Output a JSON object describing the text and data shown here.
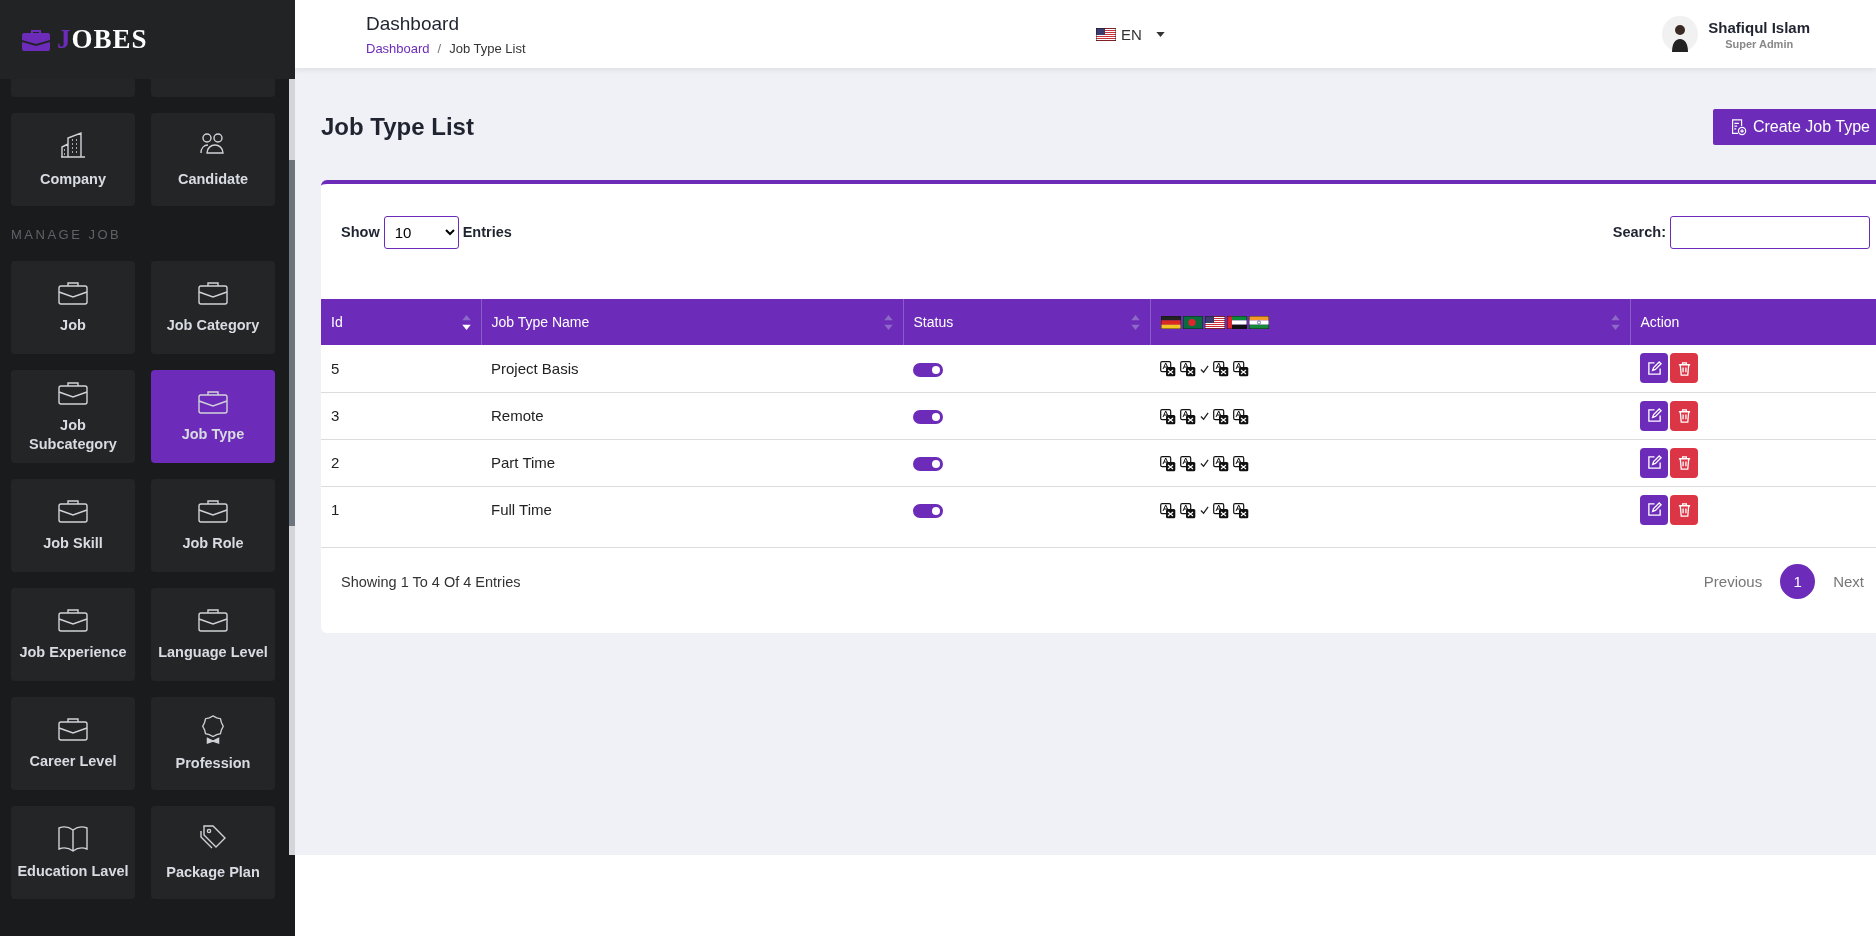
{
  "logo": {
    "text": "JOBES"
  },
  "sidebar": {
    "groups": [
      {
        "items": [
          {
            "label": "Company",
            "kind": "building",
            "selected": false
          },
          {
            "label": "Candidate",
            "kind": "people",
            "selected": false
          }
        ]
      },
      {
        "heading": "MANAGE JOB",
        "items": [
          {
            "label": "Job",
            "kind": "briefcase",
            "selected": false
          },
          {
            "label": "Job Category",
            "kind": "briefcase",
            "selected": false
          },
          {
            "label": "Job Subcategory",
            "kind": "briefcase",
            "selected": false
          },
          {
            "label": "Job Type",
            "kind": "briefcase",
            "selected": true
          },
          {
            "label": "Job Skill",
            "kind": "briefcase",
            "selected": false
          },
          {
            "label": "Job Role",
            "kind": "briefcase",
            "selected": false
          },
          {
            "label": "Job Experience",
            "kind": "briefcase",
            "selected": false
          },
          {
            "label": "Language Level",
            "kind": "briefcase",
            "selected": false
          },
          {
            "label": "Career Level",
            "kind": "briefcase",
            "selected": false
          },
          {
            "label": "Profession",
            "kind": "award",
            "selected": false
          },
          {
            "label": "Education Lavel",
            "kind": "book",
            "selected": false
          },
          {
            "label": "Package Plan",
            "kind": "tag",
            "selected": false
          }
        ]
      }
    ]
  },
  "header": {
    "title": "Dashboard",
    "breadcrumb": [
      {
        "label": "Dashboard",
        "link": true
      },
      {
        "label": "Job Type List",
        "link": false
      }
    ],
    "breadcrumb_separator": "/",
    "language": "EN",
    "user": {
      "name": "Shafiqul Islam",
      "role": "Super Admin"
    }
  },
  "page": {
    "title": "Job Type List",
    "create_button": "Create Job Type"
  },
  "table_controls": {
    "show_label": "Show",
    "page_size": "10",
    "entries_label": "Entries",
    "search_label": "Search:"
  },
  "table": {
    "columns": [
      {
        "label": "Id",
        "kind": "text",
        "sortable": true,
        "sorted": true
      },
      {
        "label": "Job Type Name",
        "kind": "text",
        "sortable": true,
        "sorted": false
      },
      {
        "label": "Status",
        "kind": "text",
        "sortable": true,
        "sorted": false
      },
      {
        "kind": "flags",
        "flags": [
          {
            "kind": "de"
          },
          {
            "kind": "bd"
          },
          {
            "kind": "us"
          },
          {
            "kind": "ae"
          },
          {
            "kind": "in"
          }
        ],
        "sortable": true,
        "sorted": false
      },
      {
        "label": "Action",
        "kind": "text",
        "sortable": false
      }
    ],
    "rows": [
      {
        "id": "5",
        "name": "Project Basis",
        "on": true,
        "translations": [
          {
            "done": false
          },
          {
            "done": false
          },
          {
            "done": true
          },
          {
            "done": false
          },
          {
            "done": false
          }
        ]
      },
      {
        "id": "3",
        "name": "Remote",
        "on": true,
        "translations": [
          {
            "done": false
          },
          {
            "done": false
          },
          {
            "done": true
          },
          {
            "done": false
          },
          {
            "done": false
          }
        ]
      },
      {
        "id": "2",
        "name": "Part Time",
        "on": true,
        "translations": [
          {
            "done": false
          },
          {
            "done": false
          },
          {
            "done": true
          },
          {
            "done": false
          },
          {
            "done": false
          }
        ]
      },
      {
        "id": "1",
        "name": "Full Time",
        "on": true,
        "translations": [
          {
            "done": false
          },
          {
            "done": false
          },
          {
            "done": true
          },
          {
            "done": false
          },
          {
            "done": false
          }
        ]
      }
    ]
  },
  "footer": {
    "info": "Showing 1 To 4 Of 4 Entries",
    "pagination": [
      {
        "label": "Previous",
        "kind": "nav"
      },
      {
        "label": "1",
        "kind": "page",
        "selected": true
      },
      {
        "label": "Next",
        "kind": "nav"
      }
    ]
  }
}
